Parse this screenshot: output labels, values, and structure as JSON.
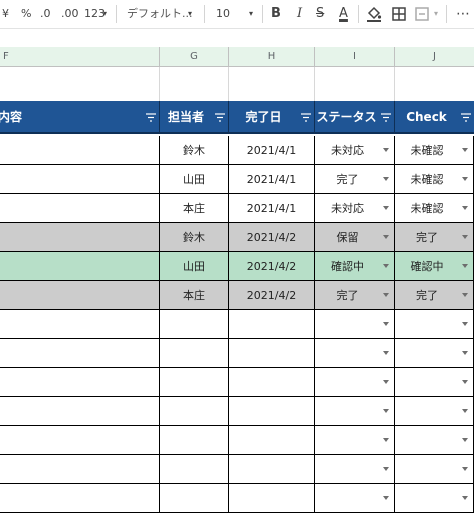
{
  "toolbar": {
    "items": [
      "¥",
      "%",
      ".0",
      ".00",
      "123"
    ],
    "font_name": "デフォルト...",
    "font_size": "10",
    "bold": "B",
    "italic": "I",
    "strike": "S",
    "textcolor": "A",
    "more": "⋯"
  },
  "colors": {
    "header_bg": "#1f5595",
    "gray_row": "#cccccc",
    "green_row": "#b7dfc8",
    "colhdr_bg": "#e6f4ea"
  },
  "columns": [
    "F",
    "G",
    "H",
    "I",
    "J"
  ],
  "headers": {
    "f": "内容",
    "g": "担当者",
    "h": "完了日",
    "i": "ステータス",
    "j": "Check"
  },
  "rows": [
    {
      "person": "鈴木",
      "date": "2021/4/1",
      "status": "未対応",
      "check": "未確認",
      "bg": "white"
    },
    {
      "person": "山田",
      "date": "2021/4/1",
      "status": "完了",
      "check": "未確認",
      "bg": "white"
    },
    {
      "person": "本庄",
      "date": "2021/4/1",
      "status": "未対応",
      "check": "未確認",
      "bg": "white"
    },
    {
      "person": "鈴木",
      "date": "2021/4/2",
      "status": "保留",
      "check": "完了",
      "bg": "gray"
    },
    {
      "person": "山田",
      "date": "2021/4/2",
      "status": "確認中",
      "check": "確認中",
      "bg": "green"
    },
    {
      "person": "本庄",
      "date": "2021/4/2",
      "status": "完了",
      "check": "完了",
      "bg": "gray"
    },
    {
      "person": "",
      "date": "",
      "status": "",
      "check": "",
      "bg": "white"
    },
    {
      "person": "",
      "date": "",
      "status": "",
      "check": "",
      "bg": "white"
    },
    {
      "person": "",
      "date": "",
      "status": "",
      "check": "",
      "bg": "white"
    },
    {
      "person": "",
      "date": "",
      "status": "",
      "check": "",
      "bg": "white"
    },
    {
      "person": "",
      "date": "",
      "status": "",
      "check": "",
      "bg": "white"
    },
    {
      "person": "",
      "date": "",
      "status": "",
      "check": "",
      "bg": "white"
    },
    {
      "person": "",
      "date": "",
      "status": "",
      "check": "",
      "bg": "white"
    }
  ]
}
